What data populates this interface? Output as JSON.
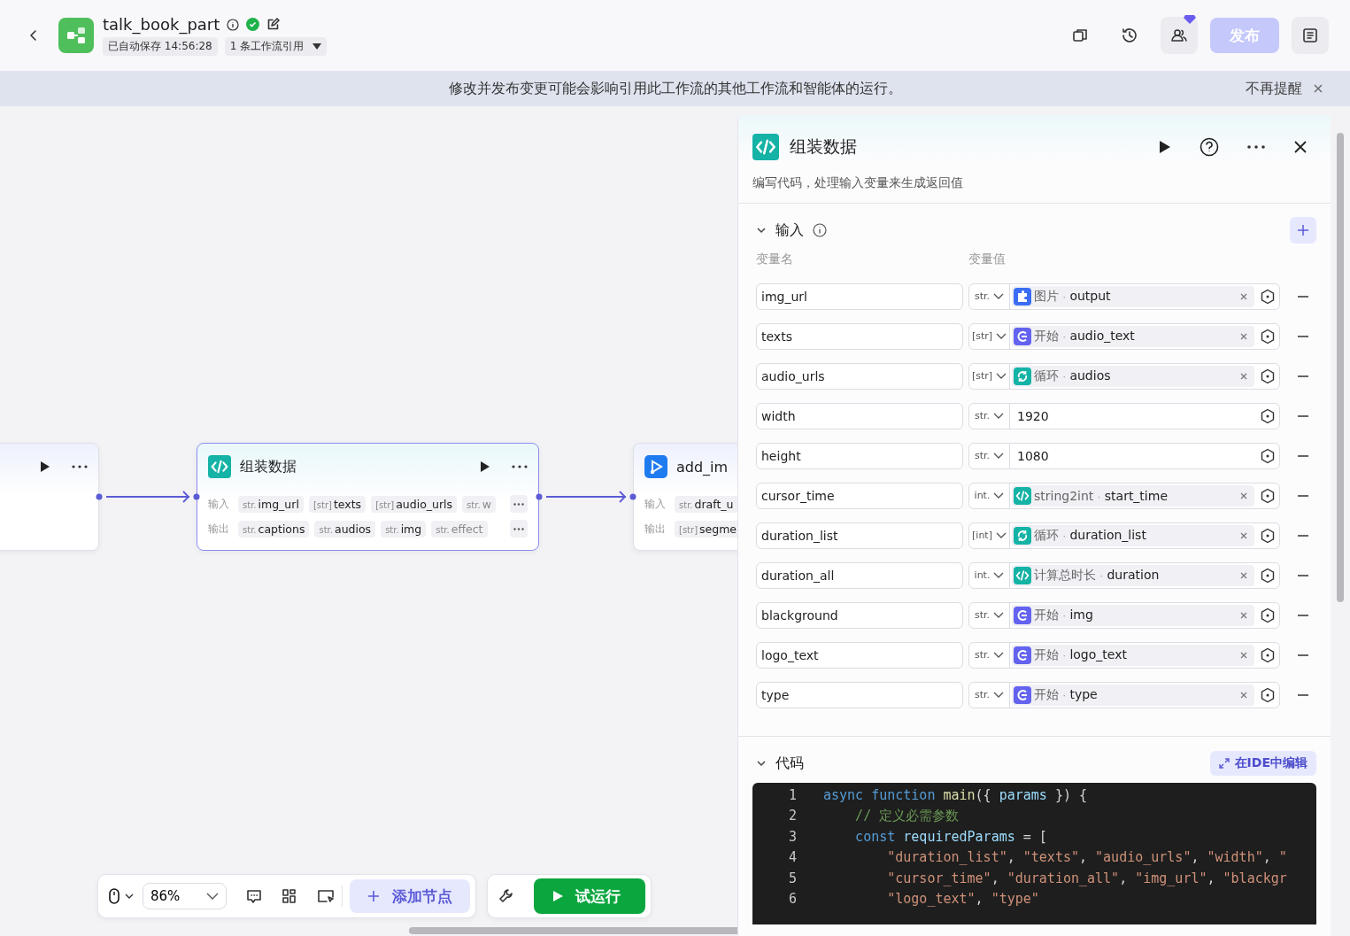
{
  "header": {
    "title": "talk_book_part",
    "autosave": "已自动保存 14:56:28",
    "references": "1 条工作流引用",
    "publish": {
      "label": "发布",
      "disabled": true
    }
  },
  "banner": {
    "message": "修改并发布变更可能会影响引用此工作流的其他工作流和智能体的运行。",
    "dismiss": "不再提醒"
  },
  "canvas": {
    "nodes": [
      {
        "kind": "partial",
        "selected": false
      },
      {
        "kind": "code",
        "title": "组装数据",
        "selected": true,
        "input_label": "输入",
        "output_label": "输出",
        "inputs": [
          {
            "type": "str.",
            "name": "img_url",
            "faded": false
          },
          {
            "type": "[str]",
            "name": "texts",
            "faded": false
          },
          {
            "type": "[str]",
            "name": "audio_urls",
            "faded": false
          },
          {
            "type": "str.",
            "name": "w",
            "faded": true
          }
        ],
        "outputs": [
          {
            "type": "str.",
            "name": "captions",
            "faded": false
          },
          {
            "type": "str.",
            "name": "audios",
            "faded": false
          },
          {
            "type": "str.",
            "name": "img",
            "faded": false
          },
          {
            "type": "str.",
            "name": "effect",
            "faded": true
          }
        ]
      },
      {
        "kind": "plugin",
        "title": "add_im",
        "selected": false,
        "input_label": "输入",
        "output_label": "输出",
        "inputs": [
          {
            "type": "str.",
            "name": "draft_u",
            "faded": false
          }
        ],
        "outputs": [
          {
            "type": "[str]",
            "name": "segme",
            "faded": false
          }
        ]
      }
    ]
  },
  "toolbar": {
    "zoom": "86%",
    "add_node": "添加节点",
    "test_run": "试运行"
  },
  "panel": {
    "title": "组装数据",
    "description": "编写代码，处理输入变量来生成返回值",
    "inputs": {
      "title": "输入",
      "expanded": true,
      "name_header": "变量名",
      "value_header": "变量值",
      "rows": [
        {
          "name": "img_url",
          "type": "str.",
          "value": {
            "kind": "plugin",
            "node": "图片",
            "separator": "·",
            "field": "output"
          }
        },
        {
          "name": "texts",
          "type": "[str]",
          "value": {
            "kind": "start",
            "node": "开始",
            "separator": "·",
            "field": "audio_text"
          }
        },
        {
          "name": "audio_urls",
          "type": "[str]",
          "value": {
            "kind": "loop",
            "node": "循环",
            "separator": "·",
            "field": "audios"
          }
        },
        {
          "name": "width",
          "type": "str.",
          "value": {
            "kind": "literal",
            "text": "1920"
          }
        },
        {
          "name": "height",
          "type": "str.",
          "value": {
            "kind": "literal",
            "text": "1080"
          }
        },
        {
          "name": "cursor_time",
          "type": "int.",
          "value": {
            "kind": "code",
            "node": "string2int",
            "separator": "·",
            "field": "start_time"
          }
        },
        {
          "name": "duration_list",
          "type": "[int]",
          "value": {
            "kind": "loop",
            "node": "循环",
            "separator": "·",
            "field": "duration_list"
          }
        },
        {
          "name": "duration_all",
          "type": "int.",
          "value": {
            "kind": "code",
            "node": "计算总时长",
            "separator": "·",
            "field": "duration"
          }
        },
        {
          "name": "blackground",
          "type": "str.",
          "value": {
            "kind": "start",
            "node": "开始",
            "separator": "·",
            "field": "img"
          }
        },
        {
          "name": "logo_text",
          "type": "str.",
          "value": {
            "kind": "start",
            "node": "开始",
            "separator": "·",
            "field": "logo_text"
          }
        },
        {
          "name": "type",
          "type": "str.",
          "value": {
            "kind": "start",
            "node": "开始",
            "separator": "·",
            "field": "type"
          }
        }
      ]
    },
    "code": {
      "title": "代码",
      "expanded": true,
      "ide_button": "在IDE中编辑",
      "lines": [
        {
          "number": "1",
          "tokens": [
            {
              "kind": "keyword",
              "text": "async"
            },
            {
              "kind": "keyword",
              "text": " function"
            },
            {
              "kind": "func",
              "text": " main"
            },
            {
              "kind": "punct",
              "text": "({ "
            },
            {
              "kind": "param",
              "text": "params"
            },
            {
              "kind": "punct",
              "text": " }) {"
            }
          ]
        },
        {
          "number": "2",
          "tokens": [
            {
              "kind": "comment",
              "text": "    // 定义必需参数"
            }
          ]
        },
        {
          "number": "3",
          "tokens": [
            {
              "kind": "keyword",
              "text": "    const"
            },
            {
              "kind": "param",
              "text": " requiredParams"
            },
            {
              "kind": "punct",
              "text": " = ["
            }
          ]
        },
        {
          "number": "4",
          "tokens": [
            {
              "kind": "string",
              "text": "        \"duration_list\""
            },
            {
              "kind": "punct",
              "text": ", "
            },
            {
              "kind": "string",
              "text": "\"texts\""
            },
            {
              "kind": "punct",
              "text": ", "
            },
            {
              "kind": "string",
              "text": "\"audio_urls\""
            },
            {
              "kind": "punct",
              "text": ", "
            },
            {
              "kind": "string",
              "text": "\"width\""
            },
            {
              "kind": "punct",
              "text": ", "
            },
            {
              "kind": "string",
              "text": "\""
            }
          ]
        },
        {
          "number": "5",
          "tokens": [
            {
              "kind": "string",
              "text": "        \"cursor_time\""
            },
            {
              "kind": "punct",
              "text": ", "
            },
            {
              "kind": "string",
              "text": "\"duration_all\""
            },
            {
              "kind": "punct",
              "text": ", "
            },
            {
              "kind": "string",
              "text": "\"img_url\""
            },
            {
              "kind": "punct",
              "text": ", "
            },
            {
              "kind": "string",
              "text": "\"blackgr"
            }
          ]
        },
        {
          "number": "6",
          "tokens": [
            {
              "kind": "string",
              "text": "        \"logo_text\""
            },
            {
              "kind": "punct",
              "text": ", "
            },
            {
              "kind": "string",
              "text": "\"type\""
            }
          ]
        }
      ]
    }
  }
}
